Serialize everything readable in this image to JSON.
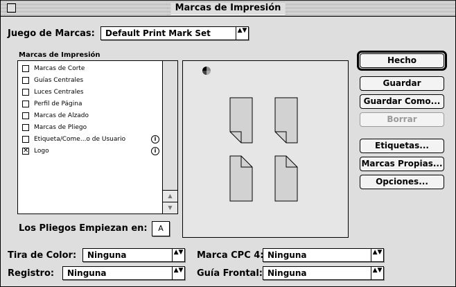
{
  "window": {
    "title": "Marcas de Impresión"
  },
  "mark_set": {
    "label": "Juego de Marcas:",
    "value": "Default Print Mark Set"
  },
  "marks_list": {
    "heading": "Marcas de Impresión",
    "items": [
      {
        "label": "Marcas de Corte",
        "checked": false,
        "has_info": false,
        "check": ""
      },
      {
        "label": "Guías Centrales",
        "checked": false,
        "has_info": false,
        "check": ""
      },
      {
        "label": "Luces Centrales",
        "checked": false,
        "has_info": false,
        "check": ""
      },
      {
        "label": "Perfil de Página",
        "checked": false,
        "has_info": false,
        "check": ""
      },
      {
        "label": "Marcas de Alzado",
        "checked": false,
        "has_info": false,
        "check": ""
      },
      {
        "label": "Marcas de Pliego",
        "checked": false,
        "has_info": false,
        "check": ""
      },
      {
        "label": "Etiqueta/Come...o de Usuario",
        "checked": false,
        "has_info": true,
        "check": ""
      },
      {
        "label": "Logo",
        "checked": true,
        "has_info": true,
        "check": "✕"
      }
    ],
    "info_glyph": "i"
  },
  "start": {
    "label": "Los Pliegos Empiezan en:",
    "value": "A"
  },
  "buttons": {
    "done": "Hecho",
    "save": "Guardar",
    "save_as": "Guardar Como...",
    "delete": "Borrar",
    "labels": "Etiquetas...",
    "own_marks": "Marcas Propias...",
    "options": "Opciones..."
  },
  "color_strip": {
    "label": "Tira de Color:",
    "value": "Ninguna"
  },
  "registration": {
    "label": "Registro:",
    "value": "Ninguna"
  },
  "cpc4": {
    "label": "Marca CPC 4:",
    "value": "Ninguna"
  },
  "front_guide": {
    "label": "Guía Frontal:",
    "value": "Ninguna"
  },
  "popup_arrows": "▲▼",
  "scroll_arrows": {
    "up": "▲",
    "down": "▼"
  },
  "colors": {
    "window_bg": "#dedede",
    "page_fill": "#d2d2d2",
    "disabled": "#9b9b9b"
  }
}
